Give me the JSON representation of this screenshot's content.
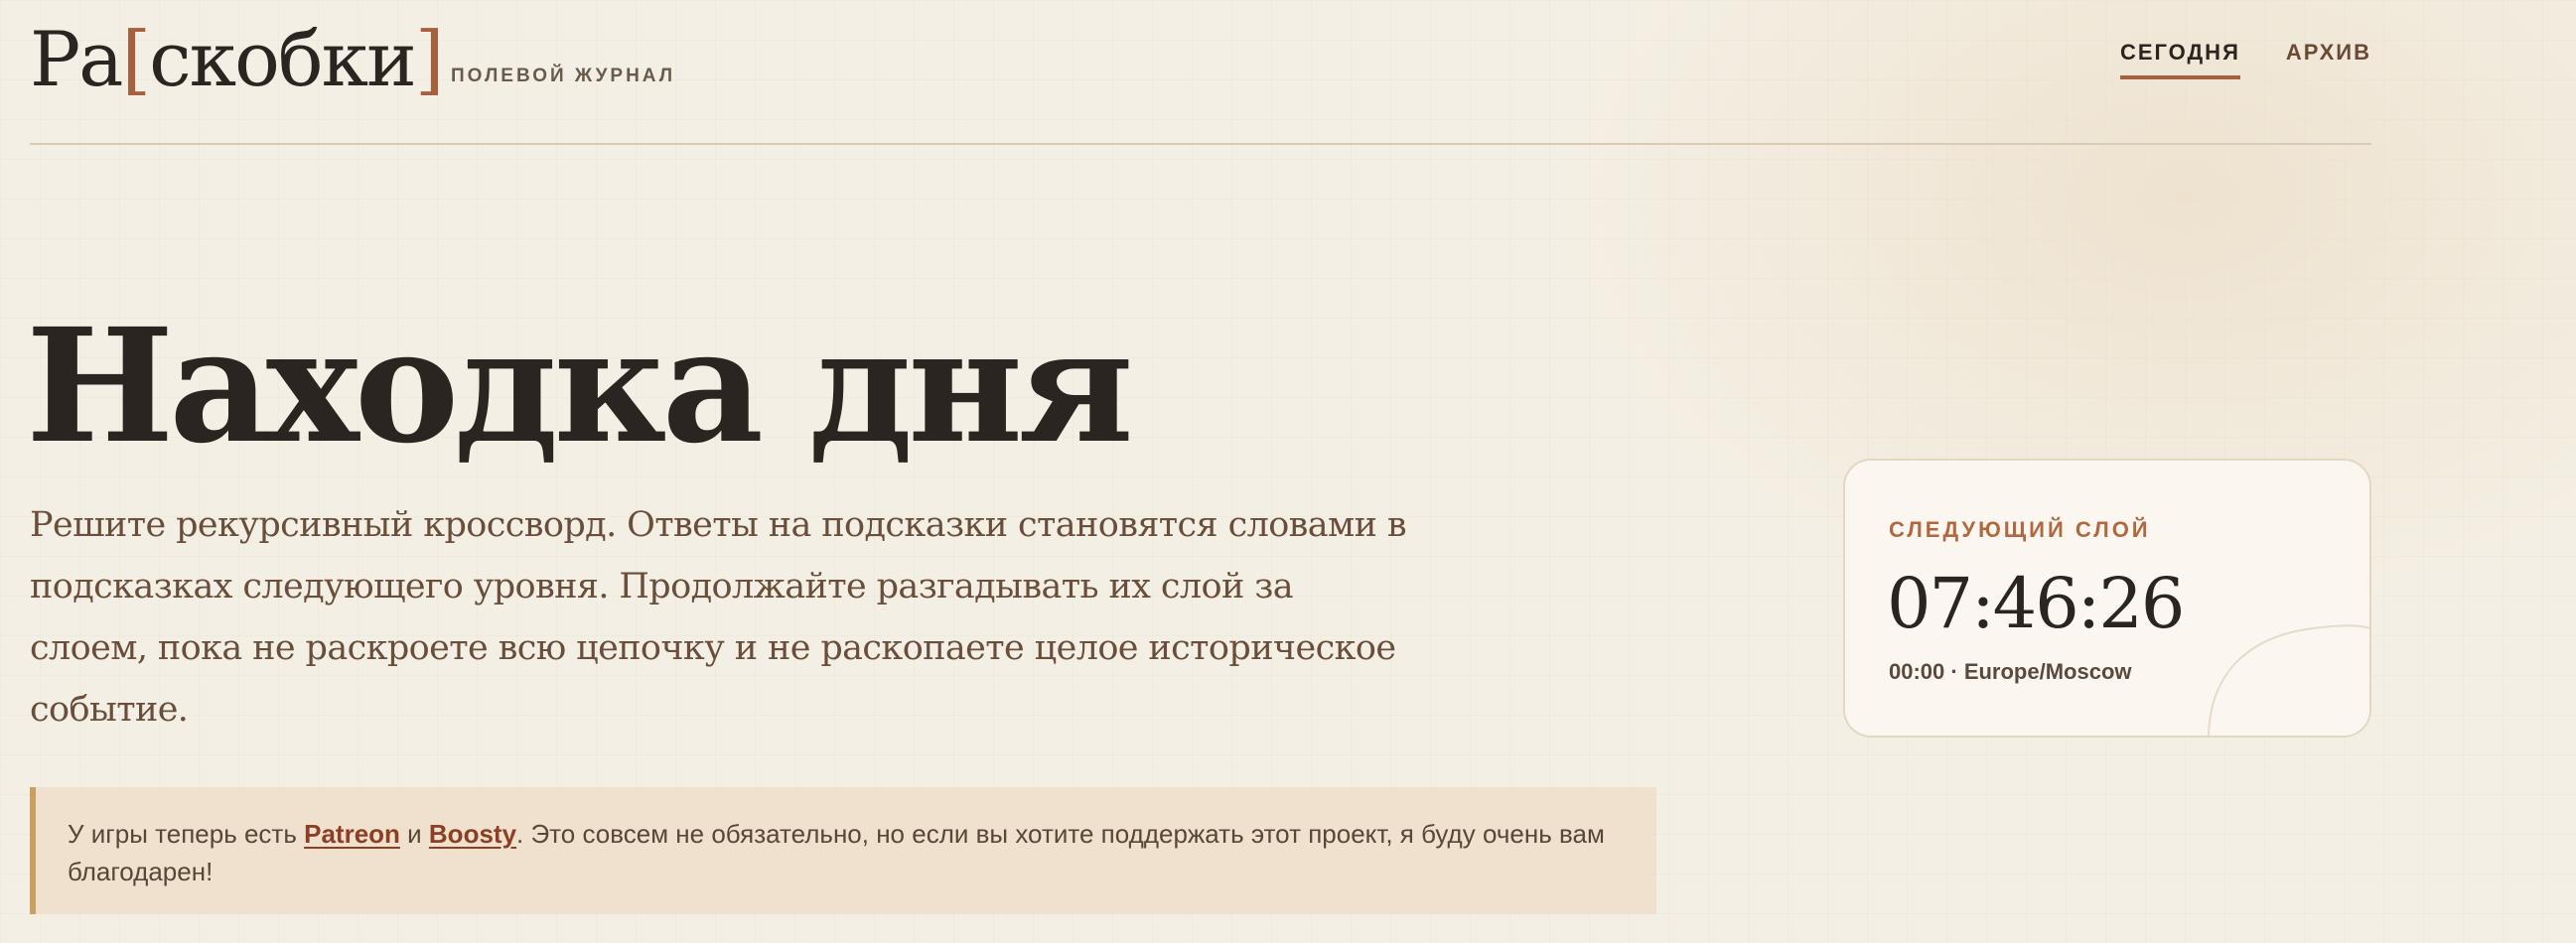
{
  "header": {
    "logo": {
      "prefix": "Ра",
      "open_bracket": "[",
      "middle": "скобки",
      "close_bracket": "]"
    },
    "tagline": "ПОЛЕВОЙ ЖУРНАЛ",
    "nav": [
      {
        "label": "СЕГОДНЯ",
        "active": true
      },
      {
        "label": "АРХИВ",
        "active": false
      }
    ]
  },
  "hero": {
    "title": "Находка дня",
    "description": "Решите рекурсивный кроссворд. Ответы на подсказки становятся словами в подсказках следующего уровня. Продолжайте разгадывать их слой за слоем, пока не раскроете всю цепочку и не раскопаете целое историческое событие."
  },
  "notice": {
    "text_before": "У игры теперь есть ",
    "link_patreon": "Patreon",
    "text_and": " и ",
    "link_boosty": "Boosty",
    "text_after": ". Это совсем не обязательно, но если вы хотите поддержать этот проект, я буду очень вам благодарен!"
  },
  "countdown": {
    "label": "СЛЕДУЮЩИЙ СЛОЙ",
    "time": "07:46:26",
    "reset": "00:00 · Europe/Moscow"
  },
  "colors": {
    "background": "#f4efe4",
    "accent": "#a6603e",
    "text": "#2a2520",
    "notice_bar": "#c8a064"
  }
}
